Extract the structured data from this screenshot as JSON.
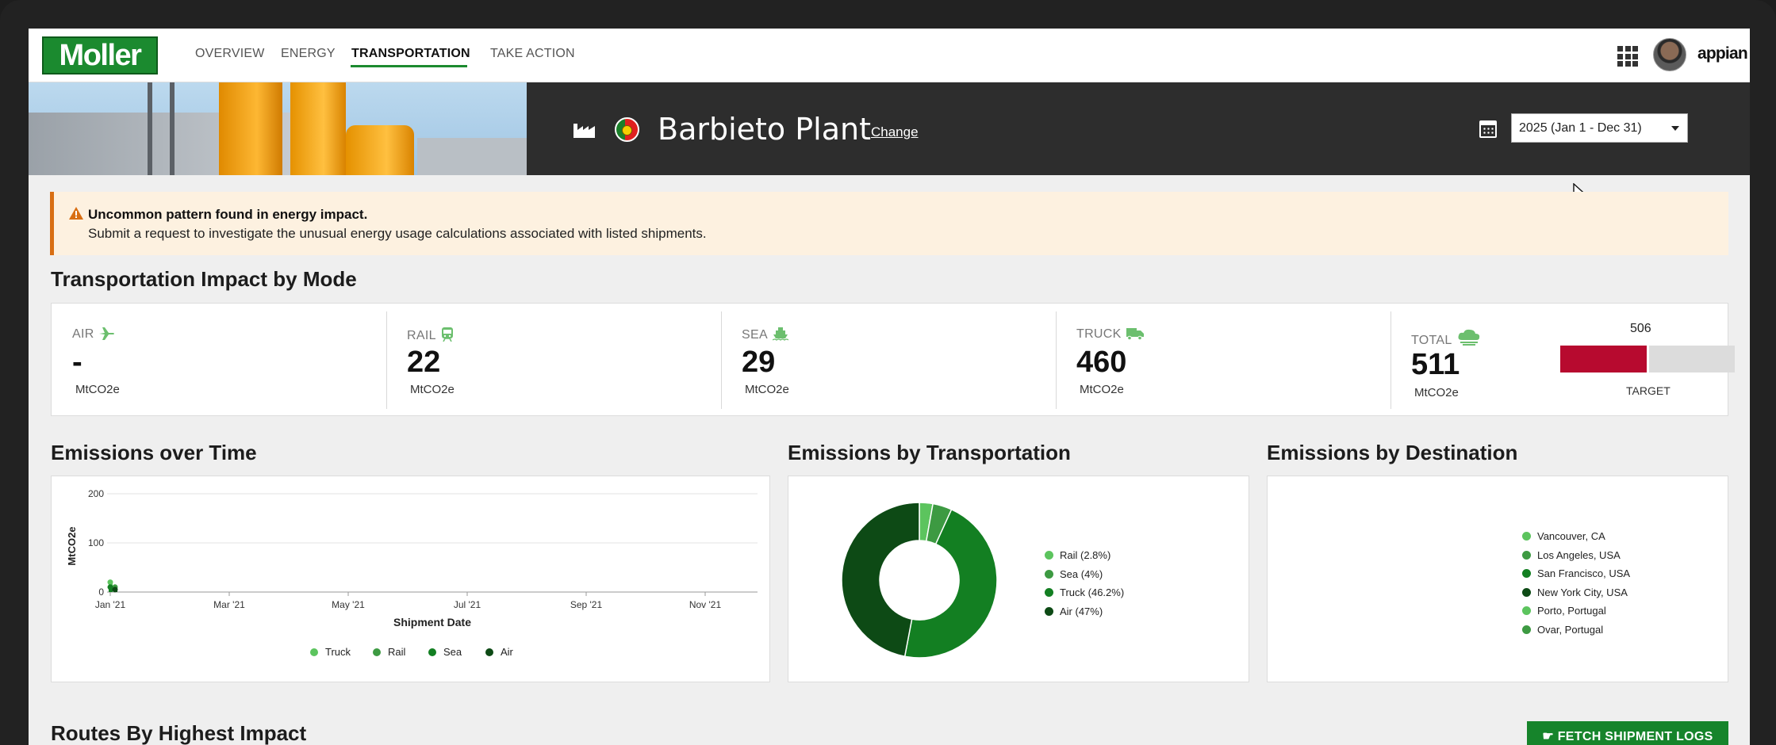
{
  "nav": {
    "logo": "Moller",
    "links": [
      "OVERVIEW",
      "ENERGY",
      "TRANSPORTATION",
      "TAKE ACTION"
    ],
    "active": "TRANSPORTATION",
    "brand": "appian"
  },
  "header": {
    "plant_name": "Barbieto Plant",
    "change_label": "Change",
    "year_select_value": "2025 (Jan 1 - Dec 31)"
  },
  "alert": {
    "title": "Uncommon pattern found in energy impact.",
    "body": "Submit a request to investigate the unusual energy usage calculations associated with listed shipments."
  },
  "impact": {
    "title": "Transportation Impact by Mode",
    "modes": [
      {
        "label": "AIR",
        "icon": "plane-icon",
        "value": "-",
        "unit": "MtCO2e"
      },
      {
        "label": "RAIL",
        "icon": "train-icon",
        "value": "22",
        "unit": "MtCO2e"
      },
      {
        "label": "SEA",
        "icon": "ship-icon",
        "value": "29",
        "unit": "MtCO2e"
      },
      {
        "label": "TRUCK",
        "icon": "truck-icon",
        "value": "460",
        "unit": "MtCO2e"
      }
    ],
    "total": {
      "label": "TOTAL",
      "icon": "cloud-icon",
      "value": "511",
      "unit": "MtCO2e",
      "target_value": "506",
      "target_label": "TARGET",
      "fill_fraction": 0.5,
      "target_fraction": 0.5
    }
  },
  "sections": {
    "time_title": "Emissions over Time",
    "transport_title": "Emissions by Transportation",
    "destination_title": "Emissions by Destination",
    "routes_title": "Routes By Highest Impact"
  },
  "fetch_button": "FETCH SHIPMENT LOGS",
  "colors": {
    "brand_green": "#1b8a2f",
    "alert_orange": "#d86e13",
    "target_red": "#b70a2f",
    "series": {
      "truck": "#5cc45e",
      "rail": "#3d9a42",
      "sea": "#137f22",
      "air": "#0d4a15"
    }
  },
  "chart_data": [
    {
      "type": "line",
      "title": "Emissions over Time",
      "xlabel": "Shipment Date",
      "ylabel": "MtCO2e",
      "ylim": [
        0,
        200
      ],
      "yticks": [
        "0",
        "100",
        "200"
      ],
      "x_ticks": [
        "Jan '21",
        "Mar '21",
        "May '21",
        "Jul '21",
        "Sep '21",
        "Nov '21"
      ],
      "grid": true,
      "legend": "bottom",
      "series": [
        {
          "name": "Truck",
          "color": "#5cc45e",
          "values": [
            20
          ]
        },
        {
          "name": "Rail",
          "color": "#3d9a42",
          "values": [
            10
          ]
        },
        {
          "name": "Sea",
          "color": "#137f22",
          "values": [
            10
          ]
        },
        {
          "name": "Air",
          "color": "#0d4a15",
          "values": [
            5
          ]
        }
      ]
    },
    {
      "type": "pie",
      "title": "Emissions by Transportation",
      "legend": "right",
      "slices": [
        {
          "label": "Rail (2.8%)",
          "value": 2.8,
          "color": "#5cc45e"
        },
        {
          "label": "Sea (4%)",
          "value": 4,
          "color": "#3d9a42"
        },
        {
          "label": "Truck (46.2%)",
          "value": 46.2,
          "color": "#137f22"
        },
        {
          "label": "Air (47%)",
          "value": 47,
          "color": "#0d4a15"
        }
      ]
    },
    {
      "type": "pie",
      "title": "Emissions by Destination",
      "legend": "right",
      "slices": [
        {
          "label": "Vancouver, CA",
          "color": "#5cc45e"
        },
        {
          "label": "Los Angeles, USA",
          "color": "#3d9a42"
        },
        {
          "label": "San Francisco, USA",
          "color": "#137f22"
        },
        {
          "label": "New York City, USA",
          "color": "#0d4a15"
        },
        {
          "label": "Porto, Portugal",
          "color": "#5cc45e"
        },
        {
          "label": "Ovar, Portugal",
          "color": "#3d9a42"
        }
      ]
    }
  ]
}
